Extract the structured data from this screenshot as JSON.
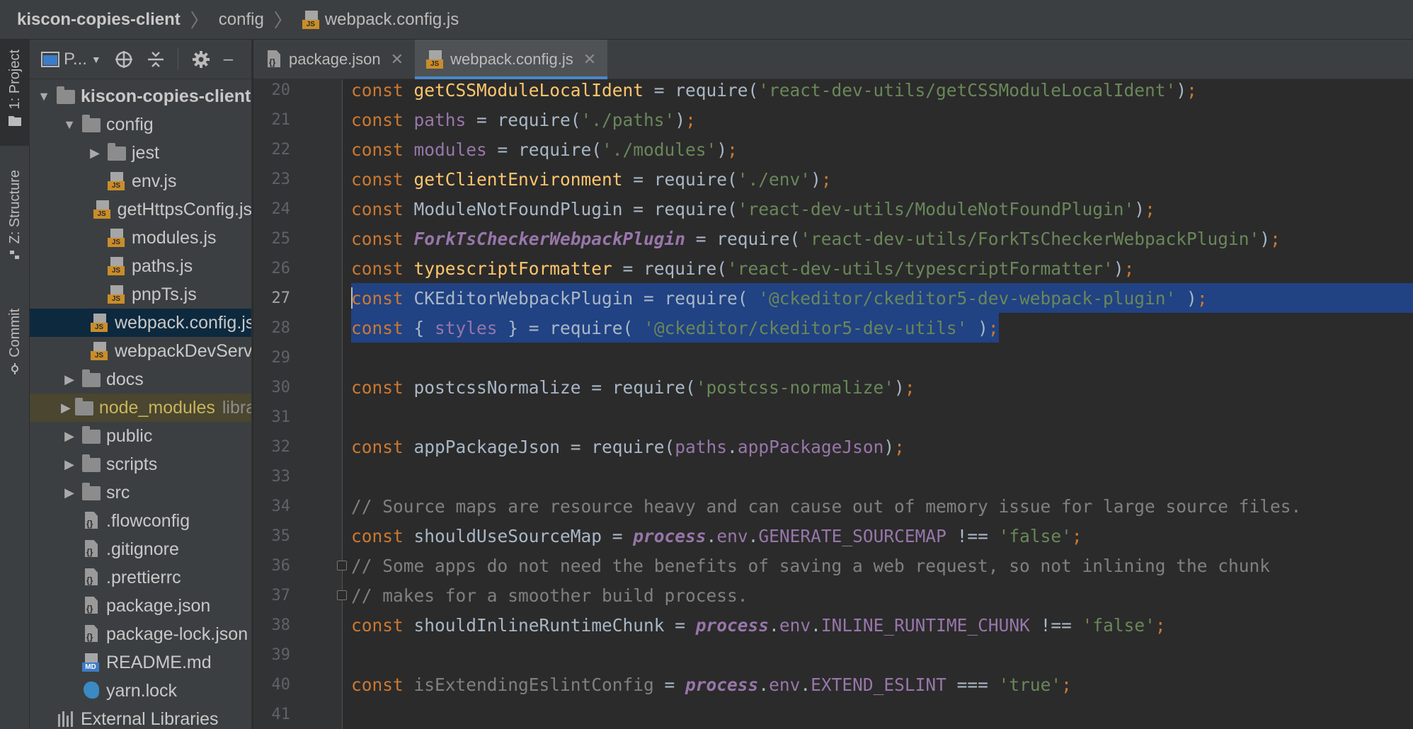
{
  "breadcrumb": {
    "project": "kiscon-copies-client",
    "folder": "config",
    "file": "webpack.config.js"
  },
  "tool_strip": {
    "project": "1: Project",
    "structure": "Z: Structure",
    "commit": "Commit"
  },
  "project_toolbar": {
    "view_label": "P..."
  },
  "tree": [
    {
      "label": "kiscon-copies-client",
      "type": "folder",
      "depth": 0,
      "arrow": "▼",
      "bold": true
    },
    {
      "label": "config",
      "type": "folder",
      "depth": 1,
      "arrow": "▼"
    },
    {
      "label": "jest",
      "type": "folder",
      "depth": 2,
      "arrow": "▶"
    },
    {
      "label": "env.js",
      "type": "js",
      "depth": 2
    },
    {
      "label": "getHttpsConfig.js",
      "type": "js",
      "depth": 2
    },
    {
      "label": "modules.js",
      "type": "js",
      "depth": 2
    },
    {
      "label": "paths.js",
      "type": "js",
      "depth": 2
    },
    {
      "label": "pnpTs.js",
      "type": "js",
      "depth": 2
    },
    {
      "label": "webpack.config.js",
      "type": "js",
      "depth": 2,
      "selected": true
    },
    {
      "label": "webpackDevServer.config.js",
      "type": "js",
      "depth": 2
    },
    {
      "label": "docs",
      "type": "folder",
      "depth": 1,
      "arrow": "▶"
    },
    {
      "label": "node_modules",
      "type": "folder",
      "depth": 1,
      "arrow": "▶",
      "excluded": true,
      "suffix": "library root"
    },
    {
      "label": "public",
      "type": "folder",
      "depth": 1,
      "arrow": "▶"
    },
    {
      "label": "scripts",
      "type": "folder",
      "depth": 1,
      "arrow": "▶"
    },
    {
      "label": "src",
      "type": "folder",
      "depth": 1,
      "arrow": "▶"
    },
    {
      "label": ".flowconfig",
      "type": "file",
      "depth": 1
    },
    {
      "label": ".gitignore",
      "type": "file",
      "depth": 1
    },
    {
      "label": ".prettierrc",
      "type": "file",
      "depth": 1
    },
    {
      "label": "package.json",
      "type": "file",
      "depth": 1
    },
    {
      "label": "package-lock.json",
      "type": "file",
      "depth": 1
    },
    {
      "label": "README.md",
      "type": "md",
      "depth": 1
    },
    {
      "label": "yarn.lock",
      "type": "yarn",
      "depth": 1
    },
    {
      "label": "External Libraries",
      "type": "lib",
      "depth": 0
    }
  ],
  "tabs": [
    {
      "label": "package.json",
      "active": false
    },
    {
      "label": "webpack.config.js",
      "active": true
    }
  ],
  "editor": {
    "current_line": 27,
    "lines": [
      {
        "n": 20,
        "tokens": [
          [
            "kw",
            "const "
          ],
          [
            "fn",
            "getCSSModuleLocalIdent"
          ],
          [
            "pl",
            " = require("
          ],
          [
            "str",
            "'react-dev-utils/getCSSModuleLocalIdent'"
          ],
          [
            "pl",
            ")"
          ],
          [
            "kw",
            ";"
          ]
        ]
      },
      {
        "n": 21,
        "tokens": [
          [
            "kw",
            "const "
          ],
          [
            "pv",
            "paths"
          ],
          [
            "pl",
            " = require("
          ],
          [
            "str",
            "'./paths'"
          ],
          [
            "pl",
            ")"
          ],
          [
            "kw",
            ";"
          ]
        ]
      },
      {
        "n": 22,
        "tokens": [
          [
            "kw",
            "const "
          ],
          [
            "pv",
            "modules"
          ],
          [
            "pl",
            " = require("
          ],
          [
            "str",
            "'./modules'"
          ],
          [
            "pl",
            ")"
          ],
          [
            "kw",
            ";"
          ]
        ]
      },
      {
        "n": 23,
        "tokens": [
          [
            "kw",
            "const "
          ],
          [
            "fn",
            "getClientEnvironment"
          ],
          [
            "pl",
            " = require("
          ],
          [
            "str",
            "'./env'"
          ],
          [
            "pl",
            ")"
          ],
          [
            "kw",
            ";"
          ]
        ]
      },
      {
        "n": 24,
        "tokens": [
          [
            "kw",
            "const "
          ],
          [
            "pl",
            "ModuleNotFoundPlugin = require("
          ],
          [
            "str",
            "'react-dev-utils/ModuleNotFoundPlugin'"
          ],
          [
            "pl",
            ")"
          ],
          [
            "kw",
            ";"
          ]
        ]
      },
      {
        "n": 25,
        "tokens": [
          [
            "kw",
            "const "
          ],
          [
            "gi",
            "ForkTsCheckerWebpackPlugin"
          ],
          [
            "pl",
            " = require("
          ],
          [
            "str",
            "'react-dev-utils/ForkTsCheckerWebpackPlugin'"
          ],
          [
            "pl",
            ")"
          ],
          [
            "kw",
            ";"
          ]
        ]
      },
      {
        "n": 26,
        "tokens": [
          [
            "kw",
            "const "
          ],
          [
            "fn",
            "typescriptFormatter"
          ],
          [
            "pl",
            " = require("
          ],
          [
            "str",
            "'react-dev-utils/typescriptFormatter'"
          ],
          [
            "pl",
            ")"
          ],
          [
            "kw",
            ";"
          ]
        ]
      },
      {
        "n": 27,
        "sel": "full",
        "tokens": [
          [
            "kw",
            "const "
          ],
          [
            "pl",
            "CKEditorWebpackPlugin = require( "
          ],
          [
            "str",
            "'@ckeditor/ckeditor5-dev-webpack-plugin'"
          ],
          [
            "pl",
            " )"
          ],
          [
            "kw",
            ";"
          ]
        ]
      },
      {
        "n": 28,
        "sel": "part",
        "tokens": [
          [
            "kw",
            "const "
          ],
          [
            "pl",
            "{ "
          ],
          [
            "pv",
            "styles"
          ],
          [
            "pl",
            " } = require( "
          ],
          [
            "str",
            "'@ckeditor/ckeditor5-dev-utils'"
          ],
          [
            "pl",
            " )"
          ],
          [
            "kw",
            ";"
          ]
        ]
      },
      {
        "n": 29,
        "tokens": []
      },
      {
        "n": 30,
        "tokens": [
          [
            "kw",
            "const "
          ],
          [
            "pl",
            "postcssNormalize = require("
          ],
          [
            "str",
            "'postcss-normalize'"
          ],
          [
            "pl",
            ")"
          ],
          [
            "kw",
            ";"
          ]
        ]
      },
      {
        "n": 31,
        "tokens": []
      },
      {
        "n": 32,
        "tokens": [
          [
            "kw",
            "const "
          ],
          [
            "pl",
            "appPackageJson = require("
          ],
          [
            "pv",
            "paths"
          ],
          [
            "pl",
            "."
          ],
          [
            "pv",
            "appPackageJson"
          ],
          [
            "pl",
            ")"
          ],
          [
            "kw",
            ";"
          ]
        ]
      },
      {
        "n": 33,
        "tokens": []
      },
      {
        "n": 34,
        "tokens": [
          [
            "cm",
            "// Source maps are resource heavy and can cause out of memory issue for large source files."
          ]
        ]
      },
      {
        "n": 35,
        "tokens": [
          [
            "kw",
            "const "
          ],
          [
            "pl",
            "shouldUseSourceMap = "
          ],
          [
            "pvi",
            "process"
          ],
          [
            "pl",
            "."
          ],
          [
            "pv",
            "env"
          ],
          [
            "pl",
            "."
          ],
          [
            "pv",
            "GENERATE_SOURCEMAP"
          ],
          [
            "pl",
            " !== "
          ],
          [
            "str",
            "'false'"
          ],
          [
            "kw",
            ";"
          ]
        ]
      },
      {
        "n": 36,
        "fold": true,
        "tokens": [
          [
            "cm",
            "// Some apps do not need the benefits of saving a web request, so not inlining the chunk"
          ]
        ]
      },
      {
        "n": 37,
        "fold": true,
        "tokens": [
          [
            "cm",
            "// makes for a smoother build process."
          ]
        ]
      },
      {
        "n": 38,
        "tokens": [
          [
            "kw",
            "const "
          ],
          [
            "pl",
            "shouldInlineRuntimeChunk = "
          ],
          [
            "pvi",
            "process"
          ],
          [
            "pl",
            "."
          ],
          [
            "pv",
            "env"
          ],
          [
            "pl",
            "."
          ],
          [
            "pv",
            "INLINE_RUNTIME_CHUNK"
          ],
          [
            "pl",
            " !== "
          ],
          [
            "str",
            "'false'"
          ],
          [
            "kw",
            ";"
          ]
        ]
      },
      {
        "n": 39,
        "tokens": []
      },
      {
        "n": 40,
        "tokens": [
          [
            "kw",
            "const "
          ],
          [
            "grey",
            "isExtendingEslintConfig"
          ],
          [
            "pl",
            " = "
          ],
          [
            "pvi",
            "process"
          ],
          [
            "pl",
            "."
          ],
          [
            "pv",
            "env"
          ],
          [
            "pl",
            "."
          ],
          [
            "pv",
            "EXTEND_ESLINT"
          ],
          [
            "pl",
            " === "
          ],
          [
            "str",
            "'true'"
          ],
          [
            "kw",
            ";"
          ]
        ]
      },
      {
        "n": 41,
        "tokens": []
      }
    ]
  },
  "colors": {
    "keyword": "#cc7832",
    "string": "#6a8759",
    "function": "#ffc66d",
    "property": "#9876aa",
    "comment": "#808080",
    "selection": "#214283",
    "tab_underline": "#4a88c7"
  }
}
